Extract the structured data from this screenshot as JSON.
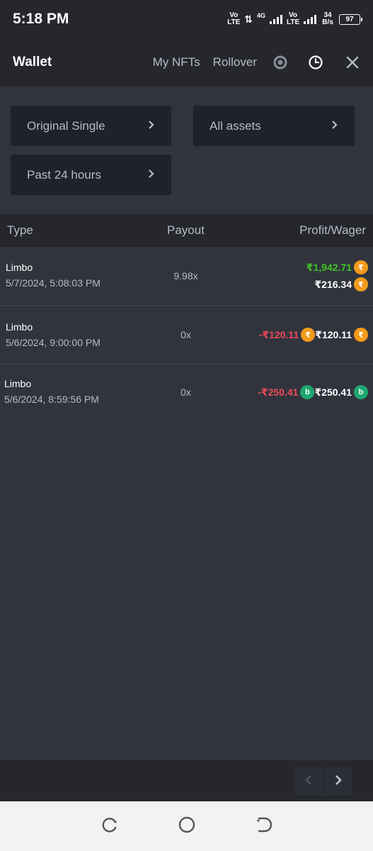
{
  "status": {
    "time": "5:18 PM",
    "volte1": "Vo LTE",
    "network": "4G",
    "volte2": "Vo LTE",
    "speed_value": "34",
    "speed_unit": "B/s",
    "battery": "97"
  },
  "header": {
    "title": "Wallet",
    "nav": [
      "My NFTs",
      "Rollover"
    ]
  },
  "filters": {
    "game": "Original Single",
    "assets": "All assets",
    "period": "Past 24 hours"
  },
  "table": {
    "headers": {
      "type": "Type",
      "payout": "Payout",
      "profit_wager": "Profit/Wager"
    },
    "rows": [
      {
        "game": "Limbo",
        "date": "5/7/2024, 5:08:03 PM",
        "payout": "9.98x",
        "profit": "₹1,942.71",
        "wager": "₹216.34",
        "coin": "inr",
        "coin_symbol": "₹"
      },
      {
        "game": "Limbo",
        "date": "5/6/2024, 9:00:00 PM",
        "payout": "0x",
        "profit": "-₹120.11",
        "wager": "₹120.11",
        "coin": "inr",
        "coin_symbol": "₹"
      },
      {
        "game": "Limbo",
        "date": "5/6/2024, 8:59:56 PM",
        "payout": "0x",
        "profit": "-₹250.41",
        "wager": "₹250.41",
        "coin": "bcd",
        "coin_symbol": "b"
      }
    ]
  },
  "colors": {
    "profit_positive": "#3ec625",
    "profit_negative": "#ee4a5a",
    "inr_coin": "#f29a1a",
    "bcd_coin": "#1ea771"
  },
  "icons": {
    "rollover": "rollover-icon",
    "history": "clock-icon",
    "close": "close-icon",
    "prev": "chevron-left-icon",
    "next": "chevron-right-icon"
  }
}
